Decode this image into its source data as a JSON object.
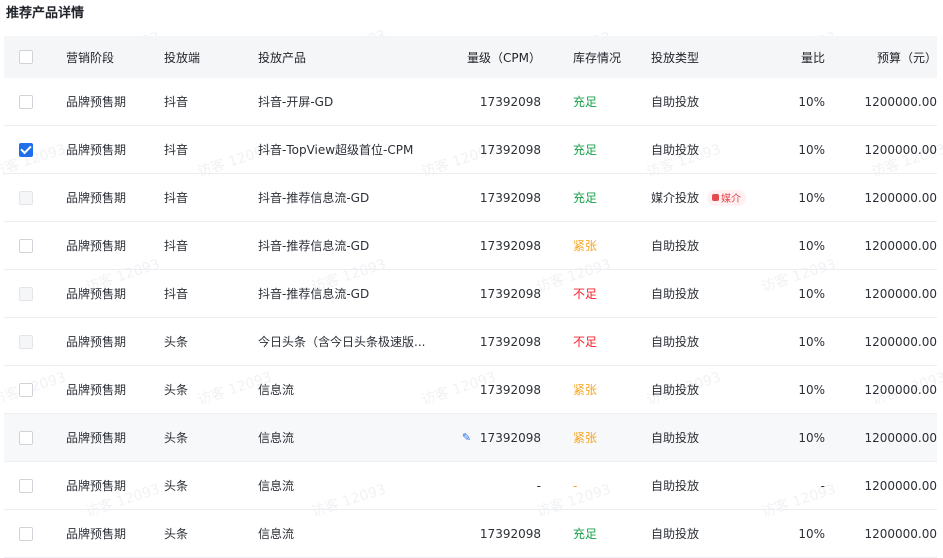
{
  "page": {
    "title": "推荐产品详情"
  },
  "colors": {
    "accent": "#1f6feb",
    "good": "#1aa34a",
    "tight": "#f5a623",
    "low": "#f5222d",
    "tag": "#e5484d"
  },
  "watermark": "访客 12093",
  "columns": {
    "stage": "营销阶段",
    "platform": "投放端",
    "product": "投放产品",
    "volume": "量级（CPM）",
    "stock": "库存情况",
    "type": "投放类型",
    "ratio": "量比",
    "budget": "预算（元）"
  },
  "rows": [
    {
      "stage": "品牌预售期",
      "platform": "抖音",
      "product": "抖音-开屏-GD",
      "volume": "17392098",
      "stock": "充足",
      "type": "自助投放",
      "ratio": "10%",
      "budget": "1200000.00"
    },
    {
      "stage": "品牌预售期",
      "platform": "抖音",
      "product": "抖音-TopView超级首位-CPM",
      "volume": "17392098",
      "stock": "充足",
      "type": "自助投放",
      "ratio": "10%",
      "budget": "1200000.00"
    },
    {
      "stage": "品牌预售期",
      "platform": "抖音",
      "product": "抖音-推荐信息流-GD",
      "volume": "17392098",
      "stock": "充足",
      "type": "媒介投放",
      "tag": "媒介",
      "ratio": "10%",
      "budget": "1200000.00"
    },
    {
      "stage": "品牌预售期",
      "platform": "抖音",
      "product": "抖音-推荐信息流-GD",
      "volume": "17392098",
      "stock": "紧张",
      "type": "自助投放",
      "ratio": "10%",
      "budget": "1200000.00"
    },
    {
      "stage": "品牌预售期",
      "platform": "抖音",
      "product": "抖音-推荐信息流-GD",
      "volume": "17392098",
      "stock": "不足",
      "type": "自助投放",
      "ratio": "10%",
      "budget": "1200000.00"
    },
    {
      "stage": "品牌预售期",
      "platform": "头条",
      "product": "今日头条（含今日头条极速版...",
      "volume": "17392098",
      "stock": "不足",
      "type": "自助投放",
      "ratio": "10%",
      "budget": "1200000.00"
    },
    {
      "stage": "品牌预售期",
      "platform": "头条",
      "product": "信息流",
      "volume": "17392098",
      "stock": "紧张",
      "type": "自助投放",
      "ratio": "10%",
      "budget": "1200000.00"
    },
    {
      "stage": "品牌预售期",
      "platform": "头条",
      "product": "信息流",
      "volume": "17392098",
      "stock": "紧张",
      "type": "自助投放",
      "ratio": "10%",
      "budget": "1200000.00"
    },
    {
      "stage": "品牌预售期",
      "platform": "头条",
      "product": "信息流",
      "volume": "-",
      "stock": "-",
      "type": "自助投放",
      "ratio": "-",
      "budget": "1200000.00"
    },
    {
      "stage": "品牌预售期",
      "platform": "头条",
      "product": "信息流",
      "volume": "17392098",
      "stock": "充足",
      "type": "自助投放",
      "ratio": "10%",
      "budget": "1200000.00"
    }
  ]
}
